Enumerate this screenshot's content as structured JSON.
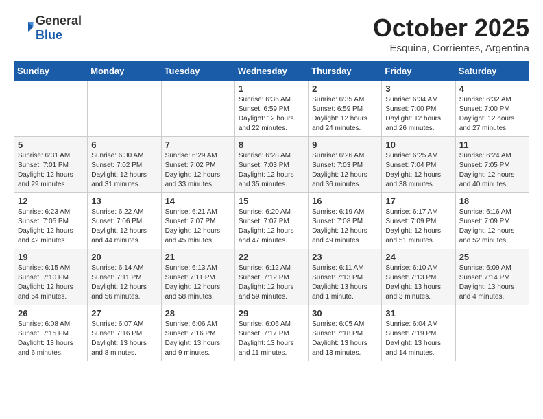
{
  "header": {
    "logo_general": "General",
    "logo_blue": "Blue",
    "month": "October 2025",
    "location": "Esquina, Corrientes, Argentina"
  },
  "days_of_week": [
    "Sunday",
    "Monday",
    "Tuesday",
    "Wednesday",
    "Thursday",
    "Friday",
    "Saturday"
  ],
  "weeks": [
    [
      {
        "day": "",
        "info": ""
      },
      {
        "day": "",
        "info": ""
      },
      {
        "day": "",
        "info": ""
      },
      {
        "day": "1",
        "info": "Sunrise: 6:36 AM\nSunset: 6:59 PM\nDaylight: 12 hours\nand 22 minutes."
      },
      {
        "day": "2",
        "info": "Sunrise: 6:35 AM\nSunset: 6:59 PM\nDaylight: 12 hours\nand 24 minutes."
      },
      {
        "day": "3",
        "info": "Sunrise: 6:34 AM\nSunset: 7:00 PM\nDaylight: 12 hours\nand 26 minutes."
      },
      {
        "day": "4",
        "info": "Sunrise: 6:32 AM\nSunset: 7:00 PM\nDaylight: 12 hours\nand 27 minutes."
      }
    ],
    [
      {
        "day": "5",
        "info": "Sunrise: 6:31 AM\nSunset: 7:01 PM\nDaylight: 12 hours\nand 29 minutes."
      },
      {
        "day": "6",
        "info": "Sunrise: 6:30 AM\nSunset: 7:02 PM\nDaylight: 12 hours\nand 31 minutes."
      },
      {
        "day": "7",
        "info": "Sunrise: 6:29 AM\nSunset: 7:02 PM\nDaylight: 12 hours\nand 33 minutes."
      },
      {
        "day": "8",
        "info": "Sunrise: 6:28 AM\nSunset: 7:03 PM\nDaylight: 12 hours\nand 35 minutes."
      },
      {
        "day": "9",
        "info": "Sunrise: 6:26 AM\nSunset: 7:03 PM\nDaylight: 12 hours\nand 36 minutes."
      },
      {
        "day": "10",
        "info": "Sunrise: 6:25 AM\nSunset: 7:04 PM\nDaylight: 12 hours\nand 38 minutes."
      },
      {
        "day": "11",
        "info": "Sunrise: 6:24 AM\nSunset: 7:05 PM\nDaylight: 12 hours\nand 40 minutes."
      }
    ],
    [
      {
        "day": "12",
        "info": "Sunrise: 6:23 AM\nSunset: 7:05 PM\nDaylight: 12 hours\nand 42 minutes."
      },
      {
        "day": "13",
        "info": "Sunrise: 6:22 AM\nSunset: 7:06 PM\nDaylight: 12 hours\nand 44 minutes."
      },
      {
        "day": "14",
        "info": "Sunrise: 6:21 AM\nSunset: 7:07 PM\nDaylight: 12 hours\nand 45 minutes."
      },
      {
        "day": "15",
        "info": "Sunrise: 6:20 AM\nSunset: 7:07 PM\nDaylight: 12 hours\nand 47 minutes."
      },
      {
        "day": "16",
        "info": "Sunrise: 6:19 AM\nSunset: 7:08 PM\nDaylight: 12 hours\nand 49 minutes."
      },
      {
        "day": "17",
        "info": "Sunrise: 6:17 AM\nSunset: 7:09 PM\nDaylight: 12 hours\nand 51 minutes."
      },
      {
        "day": "18",
        "info": "Sunrise: 6:16 AM\nSunset: 7:09 PM\nDaylight: 12 hours\nand 52 minutes."
      }
    ],
    [
      {
        "day": "19",
        "info": "Sunrise: 6:15 AM\nSunset: 7:10 PM\nDaylight: 12 hours\nand 54 minutes."
      },
      {
        "day": "20",
        "info": "Sunrise: 6:14 AM\nSunset: 7:11 PM\nDaylight: 12 hours\nand 56 minutes."
      },
      {
        "day": "21",
        "info": "Sunrise: 6:13 AM\nSunset: 7:11 PM\nDaylight: 12 hours\nand 58 minutes."
      },
      {
        "day": "22",
        "info": "Sunrise: 6:12 AM\nSunset: 7:12 PM\nDaylight: 12 hours\nand 59 minutes."
      },
      {
        "day": "23",
        "info": "Sunrise: 6:11 AM\nSunset: 7:13 PM\nDaylight: 13 hours\nand 1 minute."
      },
      {
        "day": "24",
        "info": "Sunrise: 6:10 AM\nSunset: 7:13 PM\nDaylight: 13 hours\nand 3 minutes."
      },
      {
        "day": "25",
        "info": "Sunrise: 6:09 AM\nSunset: 7:14 PM\nDaylight: 13 hours\nand 4 minutes."
      }
    ],
    [
      {
        "day": "26",
        "info": "Sunrise: 6:08 AM\nSunset: 7:15 PM\nDaylight: 13 hours\nand 6 minutes."
      },
      {
        "day": "27",
        "info": "Sunrise: 6:07 AM\nSunset: 7:16 PM\nDaylight: 13 hours\nand 8 minutes."
      },
      {
        "day": "28",
        "info": "Sunrise: 6:06 AM\nSunset: 7:16 PM\nDaylight: 13 hours\nand 9 minutes."
      },
      {
        "day": "29",
        "info": "Sunrise: 6:06 AM\nSunset: 7:17 PM\nDaylight: 13 hours\nand 11 minutes."
      },
      {
        "day": "30",
        "info": "Sunrise: 6:05 AM\nSunset: 7:18 PM\nDaylight: 13 hours\nand 13 minutes."
      },
      {
        "day": "31",
        "info": "Sunrise: 6:04 AM\nSunset: 7:19 PM\nDaylight: 13 hours\nand 14 minutes."
      },
      {
        "day": "",
        "info": ""
      }
    ]
  ]
}
